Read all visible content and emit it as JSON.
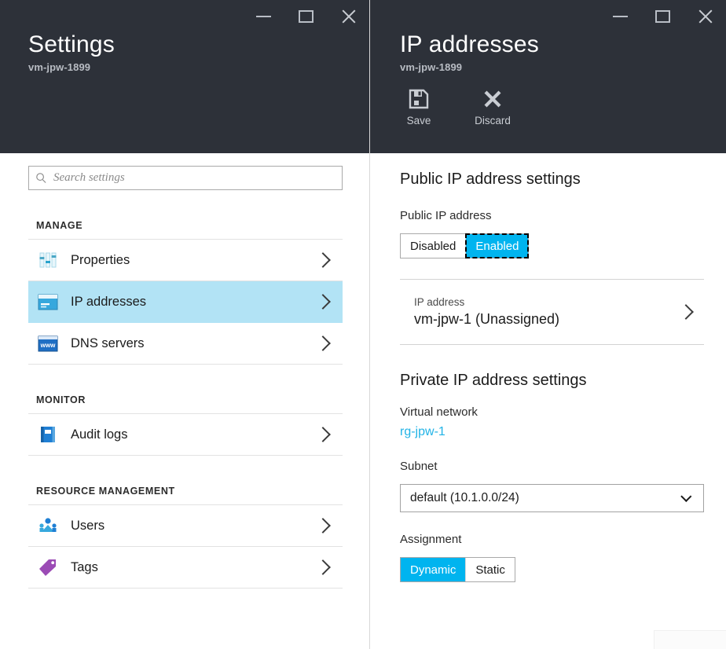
{
  "settings_blade": {
    "title": "Settings",
    "subtitle": "vm-jpw-1899",
    "window_controls": {
      "minimize": "minimize-icon",
      "maximize": "maximize-icon",
      "close": "close-icon"
    },
    "search": {
      "placeholder": "Search settings",
      "value": "",
      "icon": "search-icon"
    },
    "sections": [
      {
        "heading": "MANAGE",
        "items": [
          {
            "label": "Properties",
            "icon": "sliders-icon",
            "selected": false
          },
          {
            "label": "IP addresses",
            "icon": "ip-card-icon",
            "selected": true
          },
          {
            "label": "DNS servers",
            "icon": "www-icon",
            "selected": false
          }
        ]
      },
      {
        "heading": "MONITOR",
        "items": [
          {
            "label": "Audit logs",
            "icon": "book-icon",
            "selected": false
          }
        ]
      },
      {
        "heading": "RESOURCE MANAGEMENT",
        "items": [
          {
            "label": "Users",
            "icon": "users-icon",
            "selected": false
          },
          {
            "label": "Tags",
            "icon": "tag-icon",
            "selected": false
          }
        ]
      }
    ]
  },
  "ip_blade": {
    "title": "IP addresses",
    "subtitle": "vm-jpw-1899",
    "commands": [
      {
        "label": "Save",
        "icon": "save-icon"
      },
      {
        "label": "Discard",
        "icon": "discard-icon"
      }
    ],
    "public": {
      "heading": "Public IP address settings",
      "field_label": "Public IP address",
      "options": [
        "Disabled",
        "Enabled"
      ],
      "selected": "Enabled",
      "ip_row": {
        "label": "IP address",
        "value": "vm-jpw-1 (Unassigned)"
      }
    },
    "private": {
      "heading": "Private IP address settings",
      "vnet_label": "Virtual network",
      "vnet_value": "rg-jpw-1",
      "subnet_label": "Subnet",
      "subnet_value": "default (10.1.0.0/24)",
      "assignment_label": "Assignment",
      "assignment_options": [
        "Dynamic",
        "Static"
      ],
      "assignment_selected": "Dynamic"
    }
  },
  "colors": {
    "header_bg": "#2d3139",
    "accent": "#00b4ef",
    "selected_row": "#b2e3f5",
    "link": "#21b3e6"
  }
}
